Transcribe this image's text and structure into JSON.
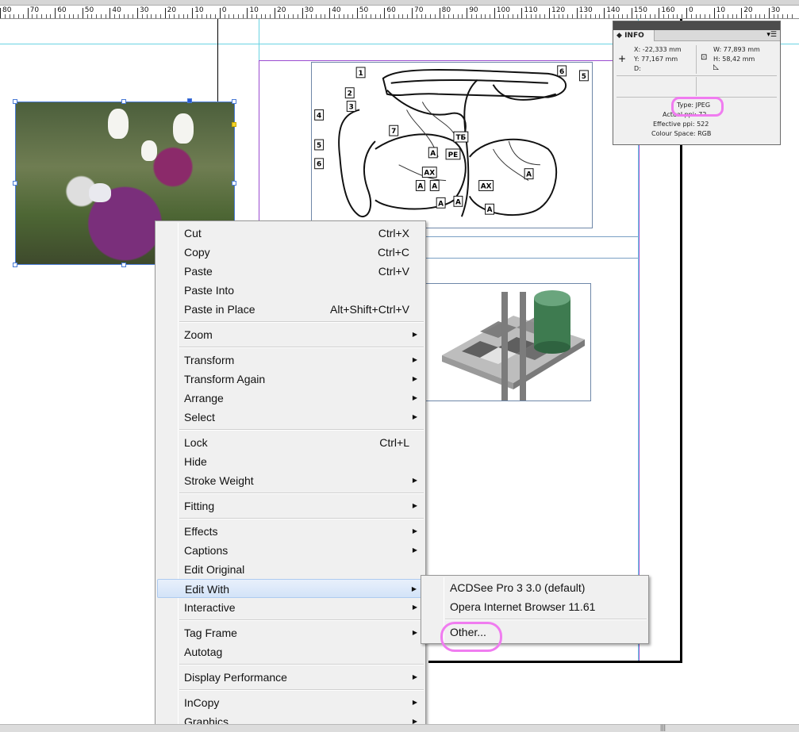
{
  "ruler": {
    "labels": [
      "80",
      "70",
      "60",
      "50",
      "40",
      "30",
      "20",
      "10",
      "0",
      "10",
      "20",
      "30",
      "40",
      "50",
      "60",
      "70",
      "80",
      "90",
      "100",
      "110",
      "120",
      "130",
      "140",
      "150",
      "160",
      "0",
      "10",
      "20",
      "30"
    ]
  },
  "info_panel": {
    "tab_label": "INFO",
    "x": "X: -22,333 mm",
    "y": "Y: 77,167 mm",
    "d": "D:",
    "w": "W: 77,893 mm",
    "h": "H: 58,42 mm",
    "type": "Type: JPEG",
    "actual_ppi": "Actual ppi: 72",
    "effective_ppi": "Effective ppi: 522",
    "colour_space": "Colour Space: RGB"
  },
  "context_menu": {
    "items": [
      {
        "label": "Cut",
        "shortcut": "Ctrl+X"
      },
      {
        "label": "Copy",
        "shortcut": "Ctrl+C"
      },
      {
        "label": "Paste",
        "shortcut": "Ctrl+V"
      },
      {
        "label": "Paste Into",
        "shortcut": ""
      },
      {
        "label": "Paste in Place",
        "shortcut": "Alt+Shift+Ctrl+V"
      },
      {
        "label": "Zoom",
        "shortcut": "",
        "submenu": true
      },
      {
        "label": "Transform",
        "shortcut": "",
        "submenu": true
      },
      {
        "label": "Transform Again",
        "shortcut": "",
        "submenu": true
      },
      {
        "label": "Arrange",
        "shortcut": "",
        "submenu": true
      },
      {
        "label": "Select",
        "shortcut": "",
        "submenu": true
      },
      {
        "label": "Lock",
        "shortcut": "Ctrl+L"
      },
      {
        "label": "Hide",
        "shortcut": ""
      },
      {
        "label": "Stroke Weight",
        "shortcut": "",
        "submenu": true
      },
      {
        "label": "Fitting",
        "shortcut": "",
        "submenu": true
      },
      {
        "label": "Effects",
        "shortcut": "",
        "submenu": true
      },
      {
        "label": "Captions",
        "shortcut": "",
        "submenu": true
      },
      {
        "label": "Edit Original",
        "shortcut": ""
      },
      {
        "label": "Edit With",
        "shortcut": "",
        "submenu": true,
        "active": true
      },
      {
        "label": "Interactive",
        "shortcut": "",
        "submenu": true
      },
      {
        "label": "Tag Frame",
        "shortcut": "",
        "submenu": true
      },
      {
        "label": "Autotag",
        "shortcut": ""
      },
      {
        "label": "Display Performance",
        "shortcut": "",
        "submenu": true
      },
      {
        "label": "InCopy",
        "shortcut": "",
        "submenu": true
      },
      {
        "label": "Graphics",
        "shortcut": "",
        "submenu": true
      }
    ]
  },
  "submenu": {
    "items": [
      {
        "label": "ACDSee Pro 3 3.0 (default)"
      },
      {
        "label": "Opera Internet Browser 11.61"
      },
      {
        "label": "Other..."
      }
    ]
  },
  "diagram_labels": [
    "1",
    "2",
    "3",
    "4",
    "5",
    "6",
    "6",
    "5",
    "7",
    "A",
    "AX",
    "A",
    "A",
    "PE",
    "ТБ",
    "A",
    "A",
    "AX",
    "A",
    "A"
  ],
  "colors": {
    "highlight_circle": "#f07cf0",
    "selection": "#4a7bd6",
    "guide": "#6ad3e2",
    "margin": "#9b4bd0"
  }
}
